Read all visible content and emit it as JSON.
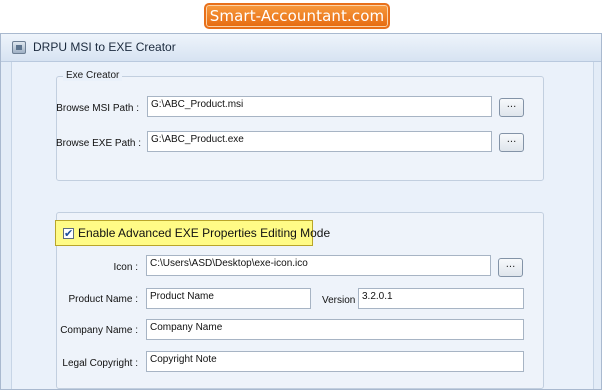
{
  "banner": {
    "text": "Smart-Accountant.com"
  },
  "window": {
    "title": "DRPU MSI to EXE Creator",
    "icon": "app-icon"
  },
  "exe_creator": {
    "legend": "Exe Creator",
    "msi_label": "Browse MSI Path :",
    "msi_value": "G:\\ABC_Product.msi",
    "exe_label": "Browse EXE Path :",
    "exe_value": "G:\\ABC_Product.exe",
    "browse_label": "..."
  },
  "advanced": {
    "checked": true,
    "check_mark": "✔",
    "label": "Enable Advanced EXE Properties Editing Mode",
    "highlight_color": "#fffb86"
  },
  "properties": {
    "icon_label": "Icon :",
    "icon_value": "C:\\Users\\ASD\\Desktop\\exe-icon.ico",
    "product_label": "Product Name :",
    "product_value": "Product Name",
    "version_label": "Version :",
    "version_value": "3.2.0.1",
    "company_label": "Company Name :",
    "company_value": "Company Name",
    "copyright_label": "Legal Copyright :",
    "copyright_value": "Copyright Note",
    "browse_label": "..."
  },
  "colors": {
    "banner": "#f07e22",
    "window_bg": "#e3ecf7"
  }
}
